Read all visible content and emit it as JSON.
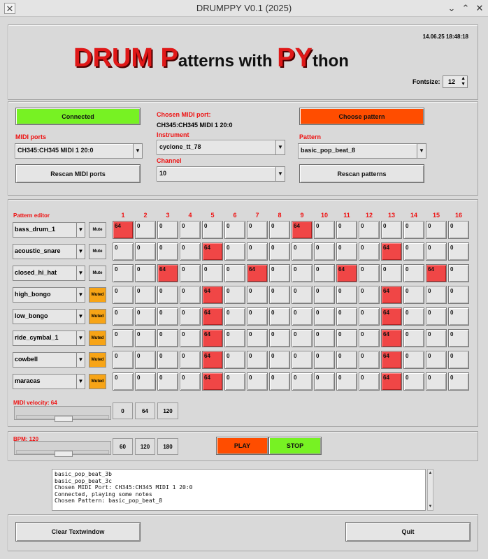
{
  "window": {
    "title": "DRUMPPY V0.1 (2025)",
    "app_icon": "x-window-icon",
    "controls": [
      "⌄",
      "⌃",
      "✕"
    ]
  },
  "header": {
    "datetime": "14.06.25 18:48:18",
    "title_parts": [
      {
        "text": "DRUM",
        "style": "big-red"
      },
      {
        "text": " ",
        "style": "gap"
      },
      {
        "text": "P",
        "style": "big-red"
      },
      {
        "text": "atterns ",
        "style": "small-black"
      },
      {
        "text": "with ",
        "style": "small-black"
      },
      {
        "text": "PY",
        "style": "big-red"
      },
      {
        "text": "thon",
        "style": "small-black"
      }
    ],
    "fontsize_label": "Fontsize:",
    "fontsize_value": "12",
    "colors": {
      "title_red": "#e01818",
      "title_shadow": "#4a0000"
    }
  },
  "connection": {
    "connected_button": "Connected",
    "connected_color": "#77f223",
    "midi_ports_label": "MIDI ports",
    "midi_port_value": "CH345:CH345 MIDI 1 20:0",
    "rescan_midi_button": "Rescan MIDI ports",
    "chosen_port_label": "Chosen MIDI port:",
    "chosen_port_value": "CH345:CH345 MIDI 1 20:0",
    "instrument_label": "Instrument",
    "instrument_value": "cyclone_tt_78",
    "channel_label": "Channel",
    "channel_value": "10",
    "choose_pattern_button": "Choose pattern",
    "choose_pattern_color": "#ff4d00",
    "pattern_label": "Pattern",
    "pattern_value": "basic_pop_beat_8",
    "rescan_patterns_button": "Rescan patterns"
  },
  "pattern_editor": {
    "label": "Pattern editor",
    "columns": [
      "1",
      "2",
      "3",
      "4",
      "5",
      "6",
      "7",
      "8",
      "9",
      "10",
      "11",
      "12",
      "13",
      "14",
      "15",
      "16"
    ],
    "active_color": "#f04646",
    "muted_color": "#f7a416",
    "rows": [
      {
        "name": "bass_drum_1",
        "mute": "Mute",
        "muted": false,
        "cells": [
          "64",
          "0",
          "0",
          "0",
          "0",
          "0",
          "0",
          "0",
          "64",
          "0",
          "0",
          "0",
          "0",
          "0",
          "0",
          "0"
        ]
      },
      {
        "name": "acoustic_snare",
        "mute": "Mute",
        "muted": false,
        "cells": [
          "0",
          "0",
          "0",
          "0",
          "64",
          "0",
          "0",
          "0",
          "0",
          "0",
          "0",
          "0",
          "64",
          "0",
          "0",
          "0"
        ]
      },
      {
        "name": "closed_hi_hat",
        "mute": "Mute",
        "muted": false,
        "cells": [
          "0",
          "0",
          "64",
          "0",
          "0",
          "0",
          "64",
          "0",
          "0",
          "0",
          "64",
          "0",
          "0",
          "0",
          "64",
          "0"
        ]
      },
      {
        "name": "high_bongo",
        "mute": "Muted",
        "muted": true,
        "cells": [
          "0",
          "0",
          "0",
          "0",
          "64",
          "0",
          "0",
          "0",
          "0",
          "0",
          "0",
          "0",
          "64",
          "0",
          "0",
          "0"
        ]
      },
      {
        "name": "low_bongo",
        "mute": "Muted",
        "muted": true,
        "cells": [
          "0",
          "0",
          "0",
          "0",
          "64",
          "0",
          "0",
          "0",
          "0",
          "0",
          "0",
          "0",
          "64",
          "0",
          "0",
          "0"
        ]
      },
      {
        "name": "ride_cymbal_1",
        "mute": "Muted",
        "muted": true,
        "cells": [
          "0",
          "0",
          "0",
          "0",
          "64",
          "0",
          "0",
          "0",
          "0",
          "0",
          "0",
          "0",
          "64",
          "0",
          "0",
          "0"
        ]
      },
      {
        "name": "cowbell",
        "mute": "Muted",
        "muted": true,
        "cells": [
          "0",
          "0",
          "0",
          "0",
          "64",
          "0",
          "0",
          "0",
          "0",
          "0",
          "0",
          "0",
          "64",
          "0",
          "0",
          "0"
        ]
      },
      {
        "name": "maracas",
        "mute": "Muted",
        "muted": true,
        "cells": [
          "0",
          "0",
          "0",
          "0",
          "64",
          "0",
          "0",
          "0",
          "0",
          "0",
          "0",
          "0",
          "64",
          "0",
          "0",
          "0"
        ]
      }
    ],
    "velocity_label": "MIDI velocity: 64",
    "velocity_level": 0.5,
    "velocity_presets": [
      "0",
      "64",
      "120"
    ]
  },
  "transport": {
    "bpm_label": "BPM: 120",
    "bpm_level": 0.5,
    "bpm_presets": [
      "60",
      "120",
      "180"
    ],
    "play_button": "PLAY",
    "play_color": "#ff4d00",
    "stop_button": "STOP",
    "stop_color": "#77f223"
  },
  "log": {
    "lines": [
      "basic_pop_beat_3b",
      "basic_pop_beat_3c",
      "Chosen MIDI Port: CH345:CH345 MIDI 1 20:0",
      "Connected, playing some notes",
      "Chosen Pattern: basic_pop_beat_8"
    ]
  },
  "footer": {
    "clear_button": "Clear Textwindow",
    "quit_button": "Quit"
  }
}
